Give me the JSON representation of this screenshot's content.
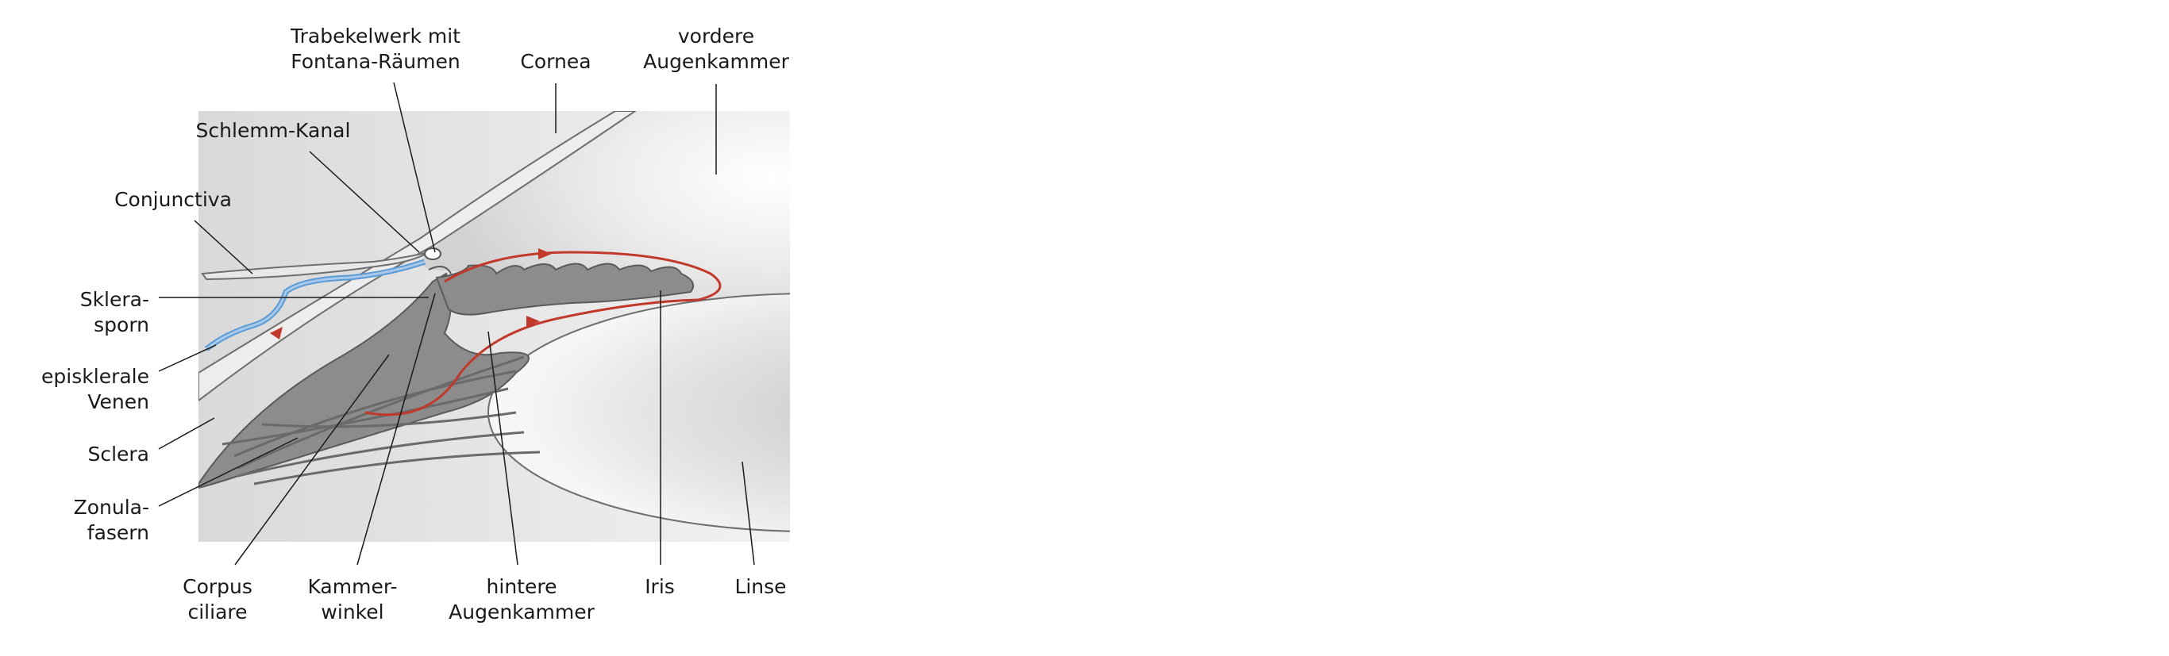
{
  "labels": {
    "trabekelwerk": [
      "Trabekelwerk mit",
      "Fontana-Räumen"
    ],
    "cornea": [
      "Cornea"
    ],
    "vordere_augenkammer": [
      "vordere",
      "Augenkammer"
    ],
    "schlemm_kanal": [
      "Schlemm-Kanal"
    ],
    "conjunctiva": [
      "Conjunctiva"
    ],
    "sklerasporn": [
      "Sklera-",
      "sporn"
    ],
    "episklerale_venen": [
      "episklerale",
      "Venen"
    ],
    "sclera": [
      "Sclera"
    ],
    "zonulafasern": [
      "Zonula-",
      "fasern"
    ],
    "corpus_ciliare": [
      "Corpus",
      "ciliare"
    ],
    "kammerwinkel": [
      "Kammer-",
      "winkel"
    ],
    "hintere_augenkammer": [
      "hintere",
      "Augenkammer"
    ],
    "iris": [
      "Iris"
    ],
    "linse": [
      "Linse"
    ]
  },
  "colors": {
    "flow_arrow": "#c0392b",
    "vein": "#5b9bd5",
    "tissue_dark": "#8a8a8a",
    "tissue_light": "#dedede"
  }
}
